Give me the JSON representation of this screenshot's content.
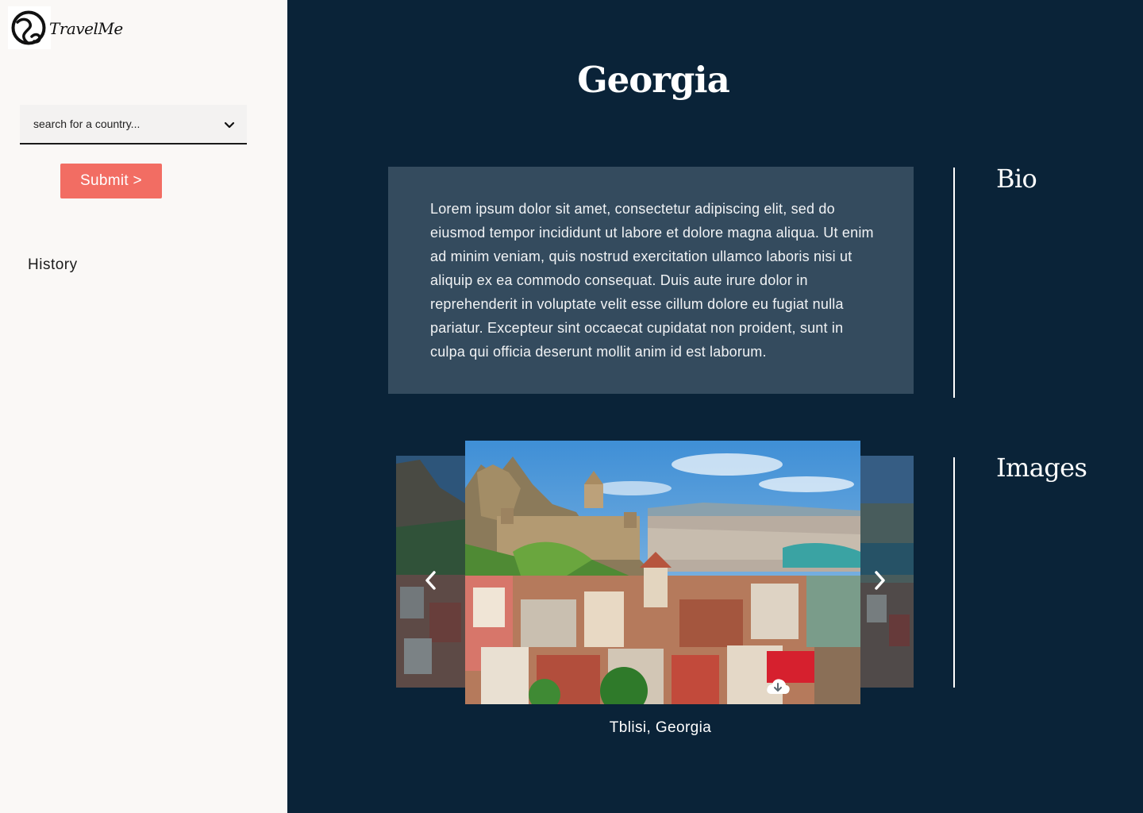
{
  "app": {
    "name": "TravelMe",
    "logo_icon": "globe-hand-icon"
  },
  "sidebar": {
    "search": {
      "placeholder": "search for a country...",
      "icon": "chevron-down-icon"
    },
    "submit_label": "Submit >",
    "history_label": "History"
  },
  "main": {
    "title": "Georgia",
    "bio": {
      "heading": "Bio",
      "text": "Lorem ipsum dolor sit amet, consectetur adipiscing elit, sed do eiusmod tempor incididunt ut labore et dolore magna aliqua. Ut enim ad minim veniam, quis nostrud exercitation ullamco laboris nisi ut aliquip ex ea commodo consequat. Duis aute irure dolor in reprehenderit in voluptate velit esse cillum dolore eu fugiat nulla pariatur. Excepteur sint occaecat cupidatat non proident, sunt in culpa qui officia deserunt mollit anim id est laborum."
    },
    "images": {
      "heading": "Images",
      "caption": "Tblisi, Georgia",
      "prev_icon": "chevron-left-icon",
      "next_icon": "chevron-right-icon",
      "download_icon": "cloud-download-icon"
    }
  },
  "colors": {
    "main_background": "#0a2338",
    "sidebar_background": "#faf8f6",
    "bio_box": "#344b5e",
    "submit_button": "#f26d63",
    "text_light": "#ffffff"
  }
}
